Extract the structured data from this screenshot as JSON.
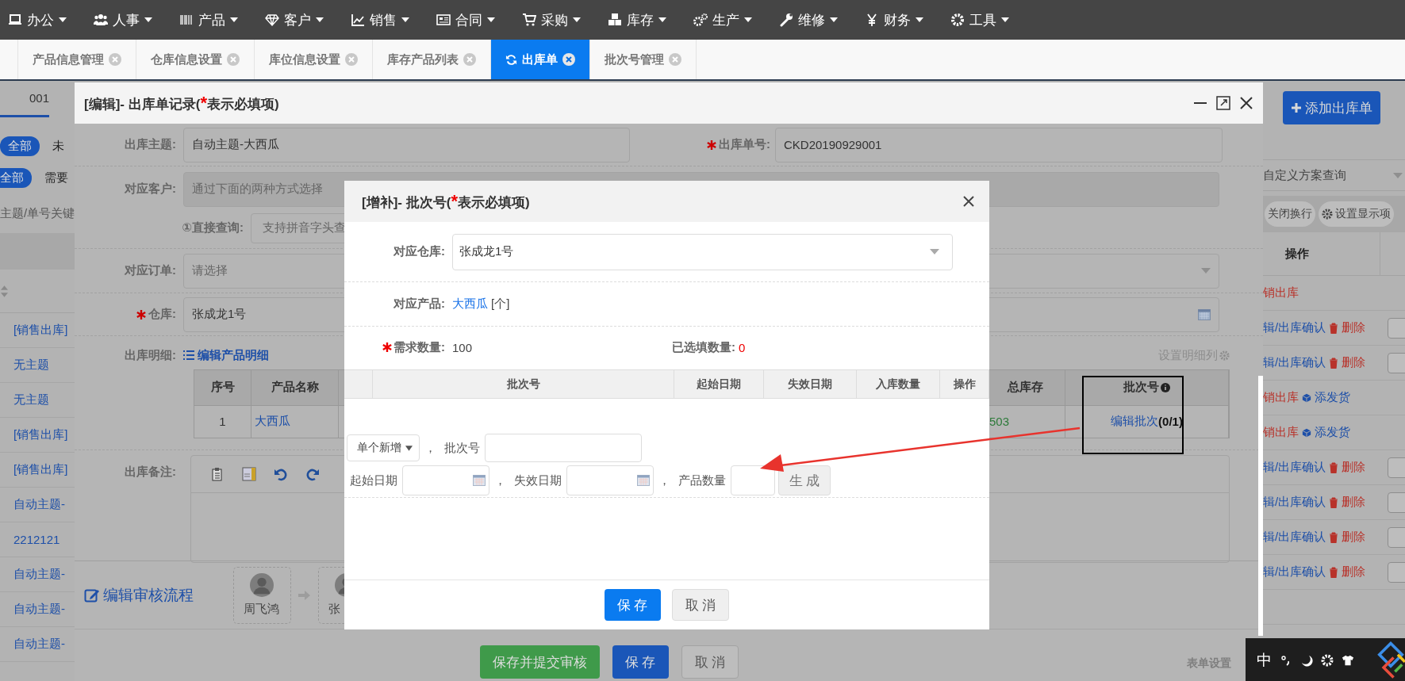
{
  "nav": [
    {
      "label": "办公"
    },
    {
      "label": "人事"
    },
    {
      "label": "产品"
    },
    {
      "label": "客户"
    },
    {
      "label": "销售"
    },
    {
      "label": "合同"
    },
    {
      "label": "采购"
    },
    {
      "label": "库存"
    },
    {
      "label": "生产"
    },
    {
      "label": "维修"
    },
    {
      "label": "财务"
    },
    {
      "label": "工具"
    }
  ],
  "tabs": [
    {
      "label": "产品信息管理",
      "selected": false
    },
    {
      "label": "仓库信息设置",
      "selected": false
    },
    {
      "label": "库位信息设置",
      "selected": false
    },
    {
      "label": "库存产品列表",
      "selected": false
    },
    {
      "label": "出库单",
      "selected": true
    },
    {
      "label": "批次号管理",
      "selected": false
    }
  ],
  "page": {
    "tab_label": "001",
    "filter_all": "全部",
    "filter_rest": "未",
    "filter2_all": "全部",
    "filter2_rest": "需要",
    "search_hint": "主题/单号关键",
    "add_button": "添加出库单",
    "scheme_select": "自定义方案查询",
    "wrap_button": "关闭换行",
    "columns_button": "设置显示项",
    "action_header": "操作",
    "rows": [
      {
        "subject": "[销售出库]",
        "kind": "done",
        "actions": [
          {
            "kind": "undo",
            "text": "销出库"
          }
        ]
      },
      {
        "subject": "无主题",
        "kind": "pending",
        "checked": false,
        "actions": [
          {
            "kind": "edit",
            "text": "辑/出库确认"
          },
          {
            "kind": "delete",
            "text": "删除"
          }
        ]
      },
      {
        "subject": "无主题",
        "kind": "pending",
        "checked": false,
        "actions": [
          {
            "kind": "edit",
            "text": "辑/出库确认"
          },
          {
            "kind": "delete",
            "text": "删除"
          }
        ]
      },
      {
        "subject": "[销售出库]",
        "kind": "done",
        "actions": [
          {
            "kind": "undo",
            "text": "销出库"
          },
          {
            "kind": "ship",
            "text": "添发货"
          }
        ]
      },
      {
        "subject": "[销售出库]",
        "kind": "done",
        "actions": [
          {
            "kind": "undo",
            "text": "销出库"
          },
          {
            "kind": "ship",
            "text": "添发货"
          }
        ]
      },
      {
        "subject": "自动主题-",
        "kind": "pending",
        "checked": false,
        "actions": [
          {
            "kind": "edit",
            "text": "辑/出库确认"
          },
          {
            "kind": "delete",
            "text": "删除"
          }
        ]
      },
      {
        "subject": "2212121",
        "kind": "pending",
        "checked": false,
        "actions": [
          {
            "kind": "edit",
            "text": "辑/出库确认"
          },
          {
            "kind": "delete",
            "text": "删除"
          }
        ]
      },
      {
        "subject": "自动主题-",
        "kind": "pending",
        "checked": false,
        "actions": [
          {
            "kind": "edit",
            "text": "辑/出库确认"
          },
          {
            "kind": "delete",
            "text": "删除"
          }
        ]
      },
      {
        "subject": "自动主题-",
        "kind": "pending",
        "checked": false,
        "actions": [
          {
            "kind": "edit",
            "text": "辑/出库确认"
          },
          {
            "kind": "delete",
            "text": "删除"
          }
        ]
      },
      {
        "subject": "自动主题-",
        "actions": []
      }
    ]
  },
  "edit_dialog": {
    "title_parts": [
      {
        "kind": "plain",
        "text": "[编辑]- 出库单记录("
      },
      {
        "kind": "required",
        "text": "*"
      },
      {
        "kind": "plain",
        "text": "表示必填项)"
      }
    ],
    "subject": {
      "label": "出库主题:",
      "value": "自动主题-大西瓜",
      "required": false
    },
    "order_no": {
      "label": "出库单号:",
      "value": "CKD20190929001",
      "required": true
    },
    "customer": {
      "label": "对应客户:",
      "placeholder": "通过下面的两种方式选择"
    },
    "direct_query": {
      "label": "①直接查询:",
      "placeholder": "支持拼音字头查"
    },
    "order": {
      "label": "对应订单:",
      "placeholder": "请选择"
    },
    "warehouse": {
      "label": "仓库:",
      "value": "张成龙1号",
      "required": true
    },
    "details": {
      "label": "出库明细:",
      "edit_link": "编辑产品明细",
      "settings_link": "设置明细列",
      "columns": [
        "序号",
        "产品名称",
        "总库存",
        "批次号"
      ],
      "rows": [
        {
          "no": "1",
          "name": "大西瓜",
          "stock": "503",
          "batch_link": "编辑批次",
          "batch_count": "(0/1)"
        }
      ]
    },
    "remark": {
      "label": "出库备注:"
    },
    "approval": {
      "edit_link": "编辑审核流程",
      "approvers": [
        {
          "name": "周飞鸿"
        },
        {
          "name": "张"
        }
      ]
    },
    "buttons": [
      {
        "kind": "success",
        "text": "保存并提交审核"
      },
      {
        "kind": "primary",
        "text": "保 存"
      },
      {
        "kind": "default",
        "text": "取 消"
      }
    ],
    "form_settings": "表单设置"
  },
  "batch_dialog": {
    "title_parts": [
      {
        "kind": "plain",
        "text": "[增补]- 批次号("
      },
      {
        "kind": "required",
        "text": "*"
      },
      {
        "kind": "plain",
        "text": "表示必填项)"
      }
    ],
    "warehouse": {
      "label": "对应仓库:",
      "value": "张成龙1号"
    },
    "product": {
      "label": "对应产品:",
      "link": "大西瓜",
      "unit": "[个]"
    },
    "quantity": {
      "label": "需求数量:",
      "value": "100",
      "required": true
    },
    "filled": {
      "label": "已选填数量:",
      "value": "0"
    },
    "columns": [
      "批次号",
      "起始日期",
      "失效日期",
      "入库数量",
      "操作"
    ],
    "entry_lines": [
      [
        {
          "kind": "select",
          "text": "单个新增"
        },
        {
          "kind": "text",
          "text": "，"
        },
        {
          "kind": "text",
          "text": "批次号"
        },
        {
          "kind": "input"
        }
      ],
      [
        {
          "kind": "text",
          "text": "起始日期"
        },
        {
          "kind": "date"
        },
        {
          "kind": "text",
          "text": "，"
        },
        {
          "kind": "text",
          "text": "失效日期"
        },
        {
          "kind": "date"
        },
        {
          "kind": "text",
          "text": "，"
        },
        {
          "kind": "text",
          "text": "产品数量"
        },
        {
          "kind": "qty"
        },
        {
          "kind": "button",
          "text": "生 成"
        }
      ]
    ],
    "buttons": [
      {
        "kind": "primary",
        "text": "保 存"
      },
      {
        "kind": "default",
        "text": "取 消"
      }
    ]
  },
  "tray": {
    "ime": "中"
  }
}
